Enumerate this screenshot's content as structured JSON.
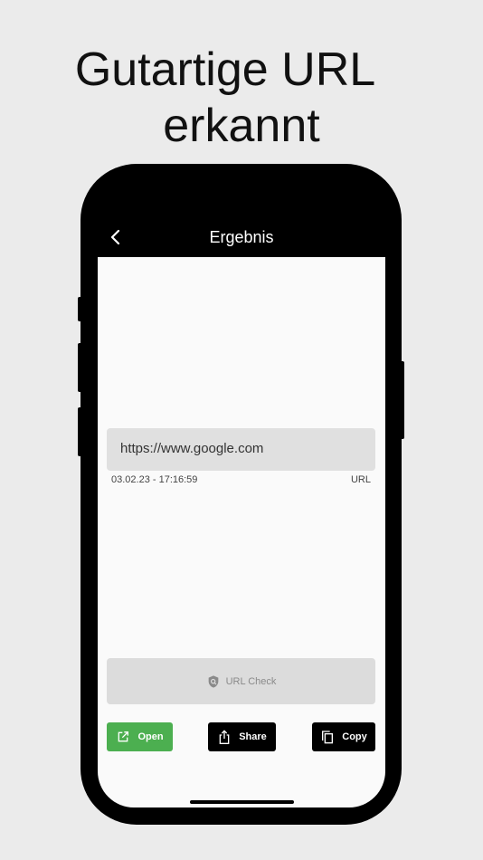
{
  "headline": {
    "line1": "Gutartige URL",
    "line2": "erkannt"
  },
  "appbar": {
    "title": "Ergebnis",
    "back_icon": "chevron-left-icon"
  },
  "result": {
    "url": "https://www.google.com",
    "timestamp": "03.02.23 - 17:16:59",
    "type": "URL"
  },
  "actions": {
    "check_label": "URL Check",
    "check_icon": "shield-search-icon",
    "open_label": "Open",
    "open_icon": "open-external-icon",
    "share_label": "Share",
    "share_icon": "share-icon",
    "copy_label": "Copy",
    "copy_icon": "copy-icon"
  },
  "colors": {
    "background": "#ebebeb",
    "phone": "#000000",
    "screen": "#fafafa",
    "open_button": "#4caf50",
    "disabled_button": "#dcdcdc"
  }
}
